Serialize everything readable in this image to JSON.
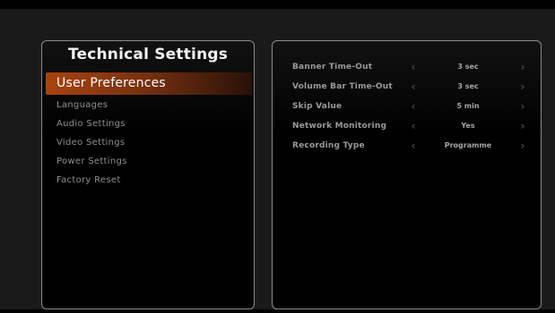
{
  "colors": {
    "accent": "#a8430f",
    "panel_border": "#8a8a8a",
    "background": "#000000"
  },
  "left_panel": {
    "title": "Technical Settings",
    "menu": [
      {
        "label": "User Preferences",
        "selected": true
      },
      {
        "label": "Languages",
        "selected": false
      },
      {
        "label": "Audio Settings",
        "selected": false
      },
      {
        "label": "Video Settings",
        "selected": false
      },
      {
        "label": "Power Settings",
        "selected": false
      },
      {
        "label": "Factory Reset",
        "selected": false
      }
    ]
  },
  "right_panel": {
    "settings": [
      {
        "label": "Banner Time-Out",
        "value": "3 sec",
        "left_icon": "chevron-left-icon",
        "right_icon": "chevron-right-icon"
      },
      {
        "label": "Volume Bar Time-Out",
        "value": "3 sec",
        "left_icon": "chevron-left-icon",
        "right_icon": "chevron-right-icon"
      },
      {
        "label": "Skip Value",
        "value": "5 min",
        "left_icon": "chevron-left-icon",
        "right_icon": "chevron-right-icon"
      },
      {
        "label": "Network Monitoring",
        "value": "Yes",
        "left_icon": "chevron-left-icon",
        "right_icon": "chevron-right-icon"
      },
      {
        "label": "Recording Type",
        "value": "Programme",
        "left_icon": "chevron-left-icon",
        "right_icon": "chevron-right-icon"
      }
    ]
  }
}
